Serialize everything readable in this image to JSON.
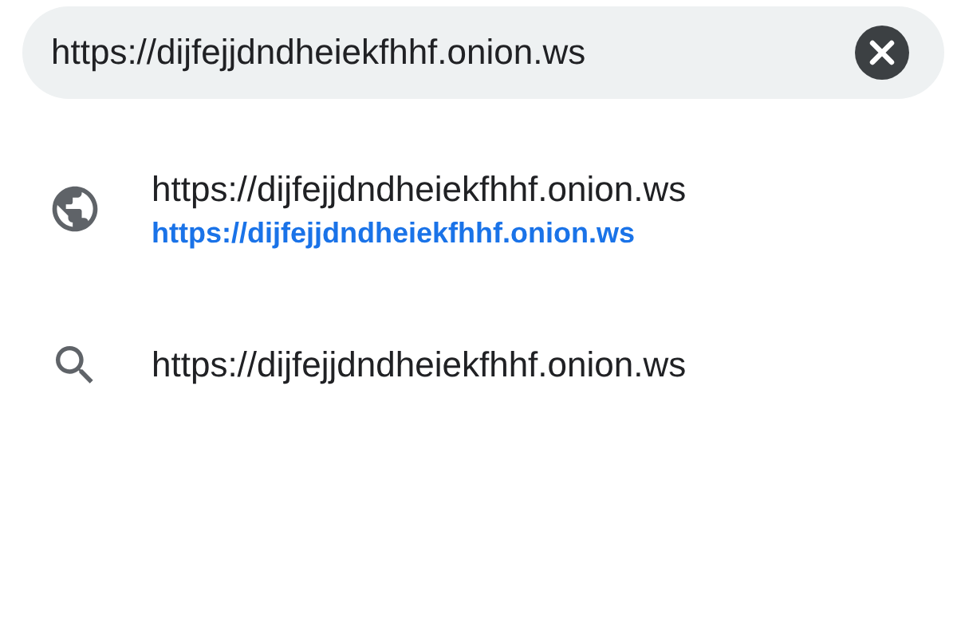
{
  "address_bar": {
    "value": "https://dijfejjdndheiekfhhf.onion.ws"
  },
  "suggestions": [
    {
      "kind": "site",
      "title": "https://dijfejjdndheiekfhhf.onion.ws",
      "url": "https://dijfejjdndheiekfhhf.onion.ws"
    },
    {
      "kind": "search",
      "title": "https://dijfejjdndheiekfhhf.onion.ws"
    }
  ]
}
